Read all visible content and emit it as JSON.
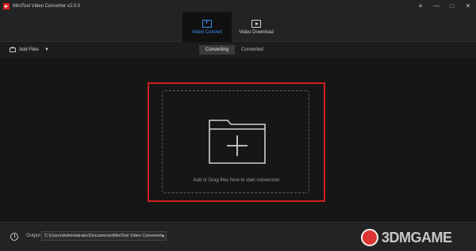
{
  "window": {
    "title": "MiniTool Video Converter v2.0.0",
    "controls": [
      "≡",
      "—",
      "□",
      "✕"
    ]
  },
  "nav": {
    "tabs": [
      {
        "label": "Video Convert",
        "icon": "video-convert-icon",
        "active": true
      },
      {
        "label": "Video Download",
        "icon": "video-download-icon",
        "active": false
      }
    ]
  },
  "toolbar": {
    "add_files_label": "Add Files",
    "add_files_caret": "▼"
  },
  "subtabs": {
    "items": [
      {
        "label": "Converting",
        "active": true
      },
      {
        "label": "Converted",
        "active": false
      }
    ]
  },
  "dropzone": {
    "text": "Add or Drag files here to start conversion",
    "icon": "add-folder-icon"
  },
  "footer": {
    "output_label": "Output",
    "output_path": "C:\\Users\\Administrator\\Documents\\MiniTool Video Converter\\",
    "output_caret": "▾"
  },
  "watermark": {
    "text": "3DMGAME"
  },
  "colors": {
    "accent": "#3a8ff5",
    "highlight_frame": "#d21f1f",
    "background": "#161616"
  }
}
